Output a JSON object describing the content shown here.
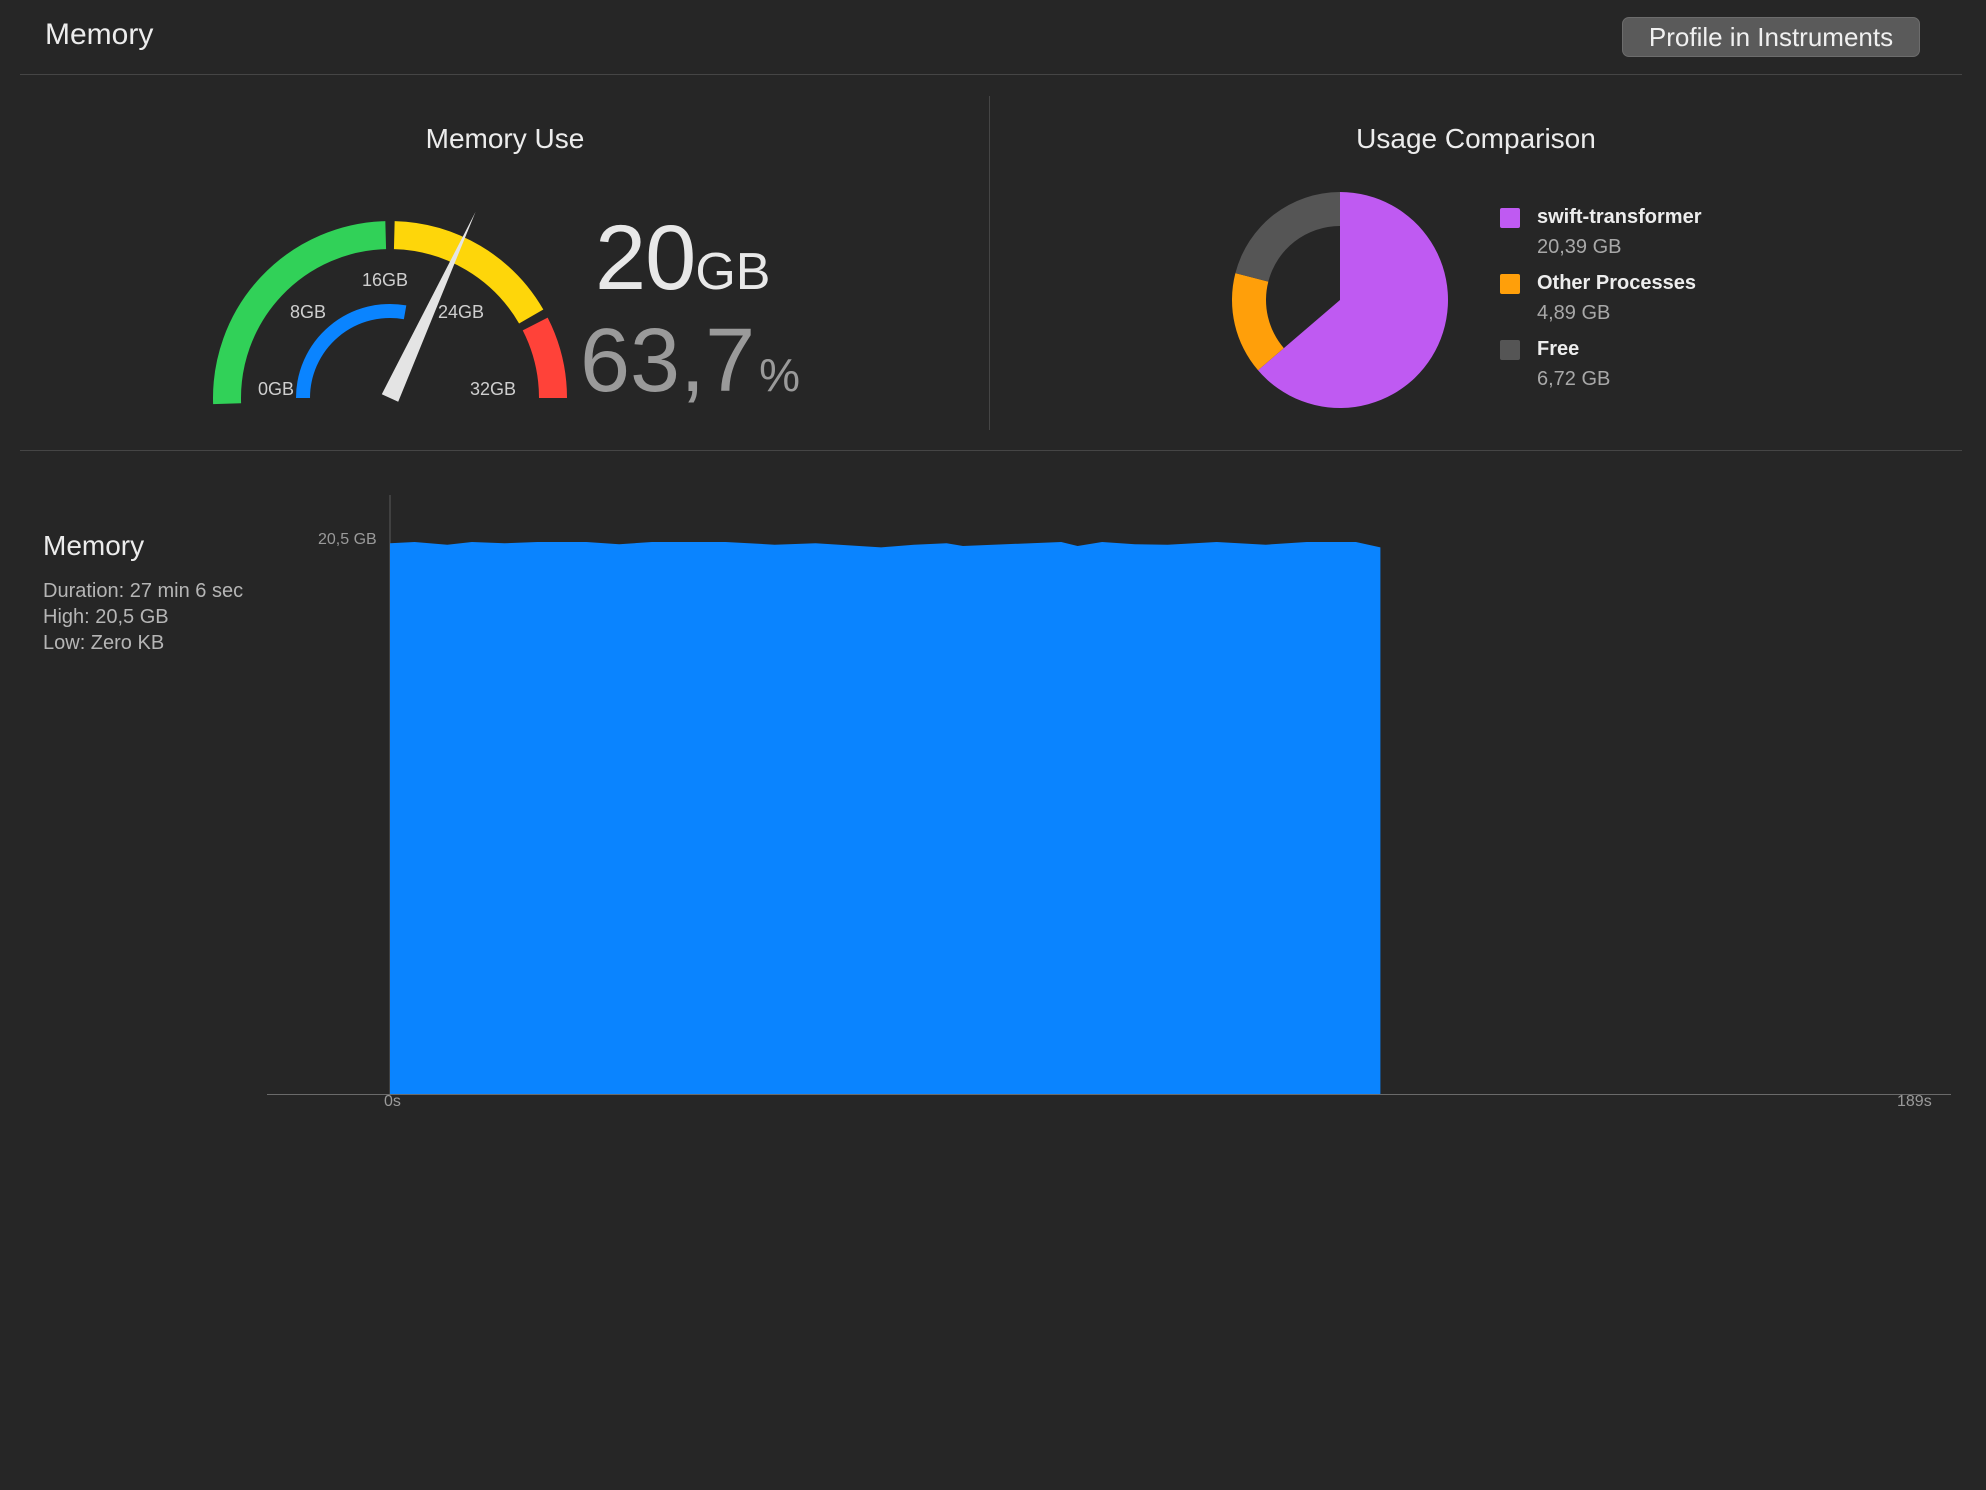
{
  "header": {
    "title": "Memory",
    "profile_button": "Profile in Instruments"
  },
  "memory_use": {
    "title": "Memory Use",
    "gauge": {
      "labels": [
        "0GB",
        "8GB",
        "16GB",
        "24GB",
        "32GB"
      ],
      "max_gb": 32,
      "value_gb": 20.39,
      "colors": {
        "green": "#31d158",
        "yellow": "#fed60a",
        "red": "#ff4239",
        "blue": "#0a84ff",
        "needle": "#e4e4e4"
      }
    },
    "value": "20",
    "value_unit": "GB",
    "percent": "63,7",
    "percent_unit": "%"
  },
  "usage_comparison": {
    "title": "Usage Comparison",
    "items": [
      {
        "name": "swift-transformer",
        "value": "20,39 GB",
        "gb": 20.39,
        "color": "#bf5af2"
      },
      {
        "name": "Other Processes",
        "value": "4,89 GB",
        "gb": 4.89,
        "color": "#ff9f0a"
      },
      {
        "name": "Free",
        "value": "6,72 GB",
        "gb": 6.72,
        "color": "#555555"
      }
    ]
  },
  "memory_chart": {
    "title": "Memory",
    "stats": {
      "duration": "Duration: 27 min 6 sec",
      "high": "High: 20,5 GB",
      "low": "Low: Zero KB"
    },
    "y_label": "20,5 GB",
    "x_start_label": "0s",
    "x_end_label": "189s",
    "fill_color": "#0a84ff"
  },
  "chart_data": {
    "type": "area",
    "x_unit": "s",
    "y_unit": "GB",
    "xlim": [
      0,
      189
    ],
    "ylim": [
      0,
      20.5
    ],
    "x": [
      0,
      3,
      7,
      10,
      14,
      18,
      24,
      28,
      32,
      36,
      41,
      47,
      52,
      60,
      64,
      68,
      70,
      82,
      84,
      87,
      91,
      95,
      101,
      107,
      112,
      118,
      121
    ],
    "y": [
      20.45,
      20.5,
      20.4,
      20.5,
      20.45,
      20.5,
      20.5,
      20.42,
      20.5,
      20.5,
      20.5,
      20.4,
      20.45,
      20.3,
      20.4,
      20.45,
      20.35,
      20.5,
      20.35,
      20.5,
      20.42,
      20.4,
      20.5,
      20.4,
      20.5,
      20.5,
      20.3
    ]
  }
}
